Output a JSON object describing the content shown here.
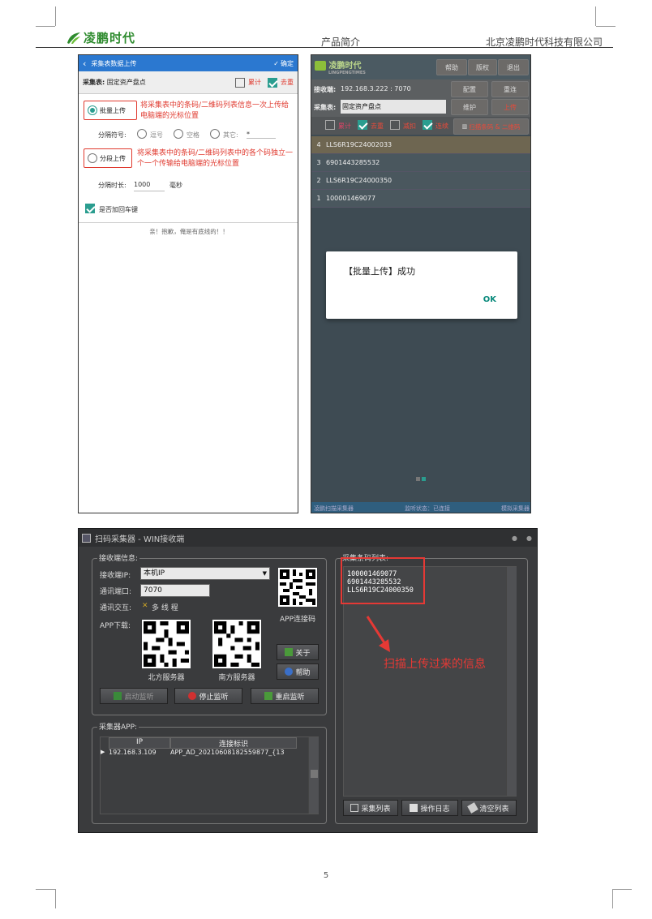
{
  "header": {
    "logo_text": "凌鹏时代",
    "section": "产品简介",
    "company": "北京凌鹏时代科技有限公司"
  },
  "phone_left": {
    "title": "采集表数据上传",
    "confirm": "确定",
    "table_label": "采集表:",
    "table_name": "固定资产盘点",
    "accumulate": "累计",
    "dedupe": "去重",
    "batch_upload": "批量上传",
    "batch_note": "将采集表中的条码/二维码列表信息一次上传给电脑端的光标位置",
    "separator_label": "分隔符号:",
    "sep_comma": "逗号",
    "sep_space": "空格",
    "sep_other": "其它:",
    "sep_other_value": "*",
    "step_upload": "分段上传",
    "step_note": "将采集表中的条码/二维码列表中的各个码独立一个一个传输给电脑端的光标位置",
    "interval_label": "分隔时长:",
    "interval_value": "1000",
    "interval_unit": "毫秒",
    "add_enter": "是否加回车键",
    "footer": "亲！抱歉，俺是有底线的！！"
  },
  "phone_right": {
    "logo_text": "凌鹏时代",
    "logo_sub": "LINGPENGTIMES",
    "btn_help": "帮助",
    "btn_copyright": "版权",
    "btn_exit": "退出",
    "receiver_label": "接收端:",
    "receiver_value": "192.168.3.222 : 7070",
    "btn_config": "配置",
    "btn_reconnect": "重连",
    "table_label": "采集表:",
    "table_name": "固定资产盘点",
    "btn_maintain": "维护",
    "btn_upload": "上传",
    "opt_accumulate": "累计",
    "opt_dedupe": "去重",
    "opt_decrease": "减扣",
    "opt_continuous": "连续",
    "btn_scan": "扫描条码 & 二维码",
    "items": [
      {
        "n": "4",
        "code": "LLS6R19C24002033"
      },
      {
        "n": "3",
        "code": "6901443285532"
      },
      {
        "n": "2",
        "code": "LLS6R19C24000350"
      },
      {
        "n": "1",
        "code": "100001469077"
      }
    ],
    "dialog_msg": "【批量上传】成功",
    "dialog_ok": "OK",
    "status_left": "凌鹏扫描采集器",
    "status_mid": "监听状态：已连接",
    "status_right": "模拟采集器"
  },
  "win": {
    "title": "扫码采集器 - WIN接收端",
    "group_receiver": "接收端信息:",
    "ip_label": "接收端IP:",
    "ip_value": "本机IP",
    "port_label": "通讯端口:",
    "port_value": "7070",
    "mode_label": "通讯交互:",
    "mode_value": "多 线 程",
    "app_download": "APP下载:",
    "app_connect": "APP连接码",
    "north": "北方服务器",
    "south": "南方服务器",
    "btn_about": "关于",
    "btn_help": "帮助",
    "btn_start": "启动监听",
    "btn_stop": "停止监听",
    "btn_restart": "重启监听",
    "group_app": "采集器APP:",
    "col_ip": "IP",
    "col_id": "连接标识",
    "row_ip": "192.168.3.109",
    "row_id": "APP_AD_20210608182559877_{13",
    "group_list": "采集条码列表:",
    "codes": [
      "100001469077",
      "6901443285532",
      "LLS6R19C24000350"
    ],
    "annotation": "扫描上传过来的信息",
    "btn_list": "采集列表",
    "btn_log": "操作日志",
    "btn_clear": "清空列表"
  },
  "page_number": "5"
}
